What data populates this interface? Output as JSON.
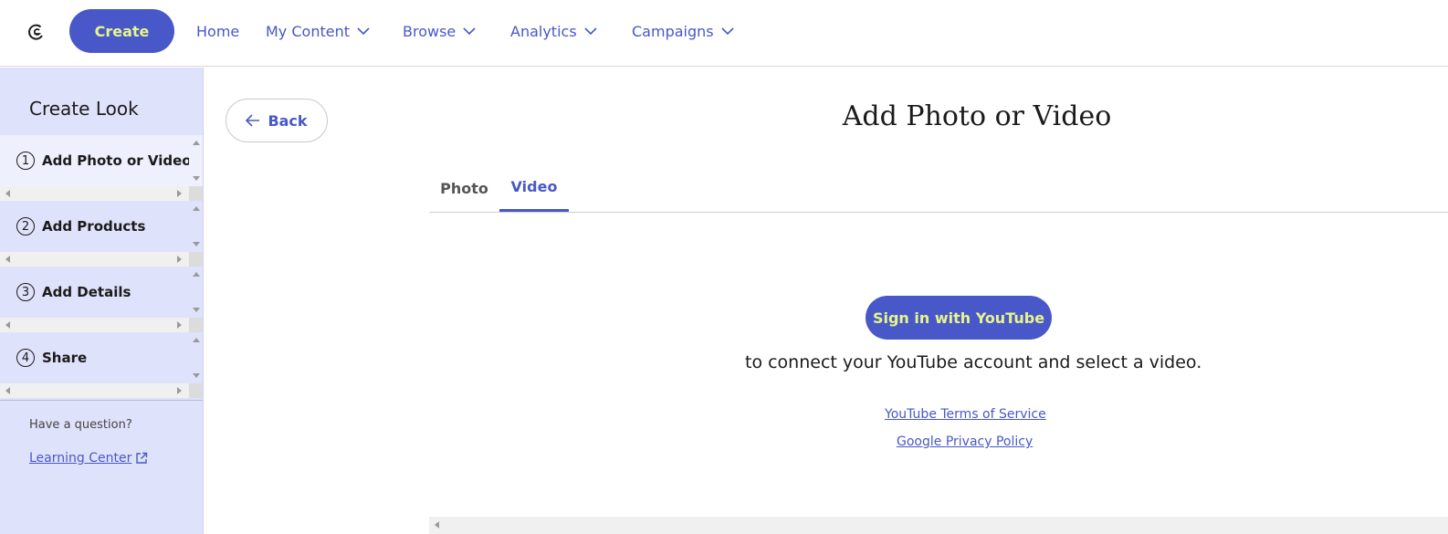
{
  "nav": {
    "logo_icon": "brand-logo-icon",
    "create_label": "Create",
    "items": [
      {
        "label": "Home",
        "has_dropdown": false
      },
      {
        "label": "My Content",
        "has_dropdown": true
      },
      {
        "label": "Browse",
        "has_dropdown": true
      },
      {
        "label": "Analytics",
        "has_dropdown": true
      },
      {
        "label": "Campaigns",
        "has_dropdown": true
      }
    ]
  },
  "sidebar": {
    "title": "Create Look",
    "steps": [
      {
        "num": "1",
        "label": "Add Photo or Video",
        "active": true
      },
      {
        "num": "2",
        "label": "Add Products",
        "active": false
      },
      {
        "num": "3",
        "label": "Add Details",
        "active": false
      },
      {
        "num": "4",
        "label": "Share",
        "active": false
      }
    ],
    "question": "Have a question?",
    "learning_center": "Learning Center"
  },
  "main": {
    "back_label": "Back",
    "title": "Add Photo or Video",
    "tabs": [
      {
        "label": "Photo",
        "selected": false
      },
      {
        "label": "Video",
        "selected": true
      }
    ],
    "signin_label": "Sign in with YouTube",
    "connect_text": "to connect your YouTube account and select a video.",
    "links": {
      "tos": "YouTube Terms of Service",
      "privacy": "Google Privacy Policy"
    }
  },
  "colors": {
    "accent": "#4858c8",
    "accent_text": "#e8f58a",
    "sidebar_bg": "#dfe2fb"
  }
}
